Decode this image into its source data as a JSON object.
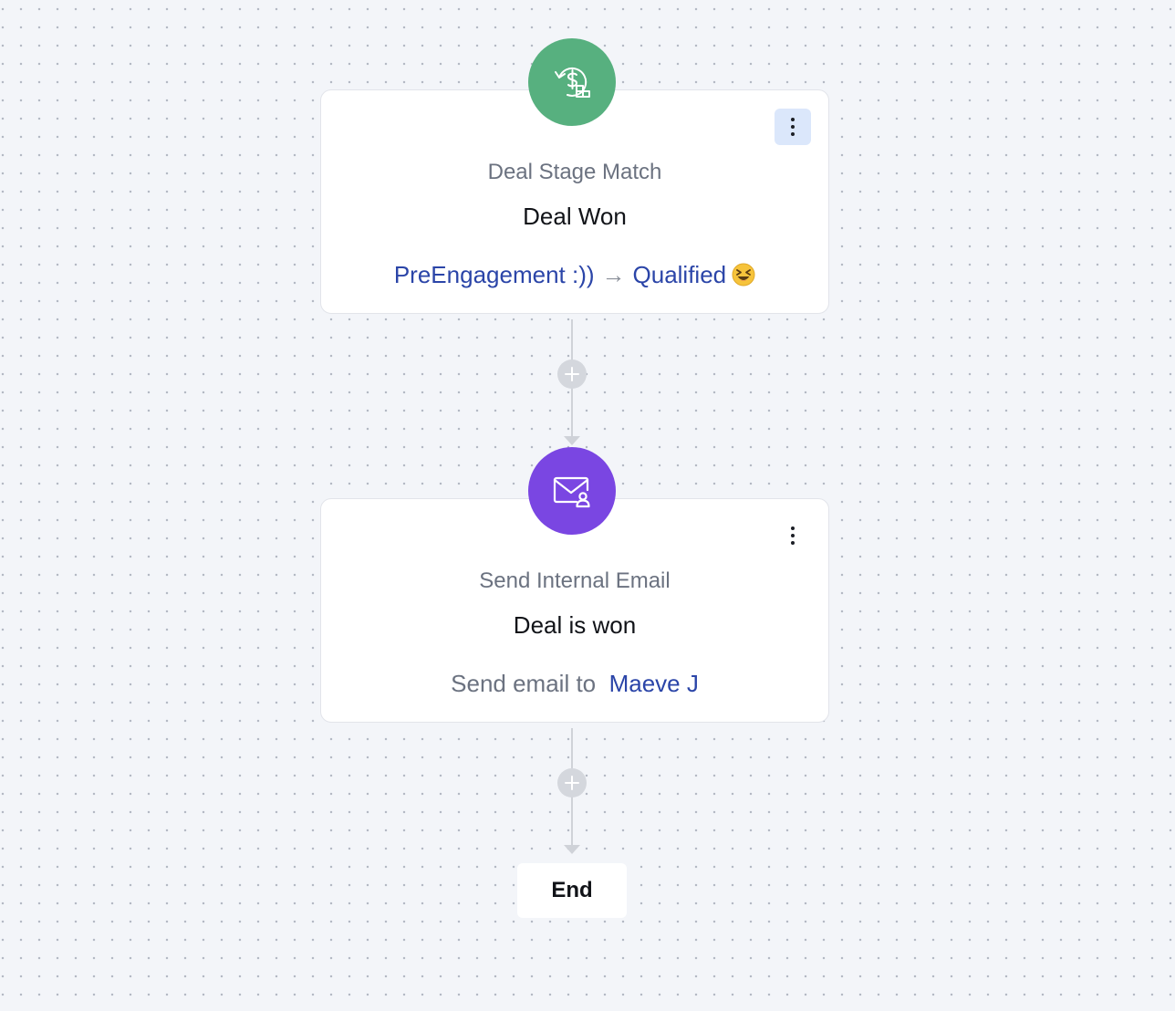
{
  "workflow": {
    "trigger": {
      "icon": "deal-stage-icon",
      "icon_color": "#57b07f",
      "type_label": "Deal Stage Match",
      "name": "Deal Won",
      "from_stage": "PreEngagement :))",
      "arrow": "→",
      "to_stage": "Qualified",
      "emoji": "laughing-face-emoji",
      "menu_icon": "more-vertical-icon",
      "menu_active": true
    },
    "action": {
      "icon": "email-user-icon",
      "icon_color": "#7a46e2",
      "type_label": "Send Internal Email",
      "name": "Deal is won",
      "detail_prefix": "Send email to",
      "recipient": "Maeve J",
      "menu_icon": "more-vertical-icon",
      "menu_active": false
    },
    "add_step_icon": "plus-icon",
    "end_label": "End"
  },
  "colors": {
    "link": "#2b45a8",
    "menu_active_bg": "#dbe7fb",
    "canvas_bg": "#f3f5f9"
  }
}
